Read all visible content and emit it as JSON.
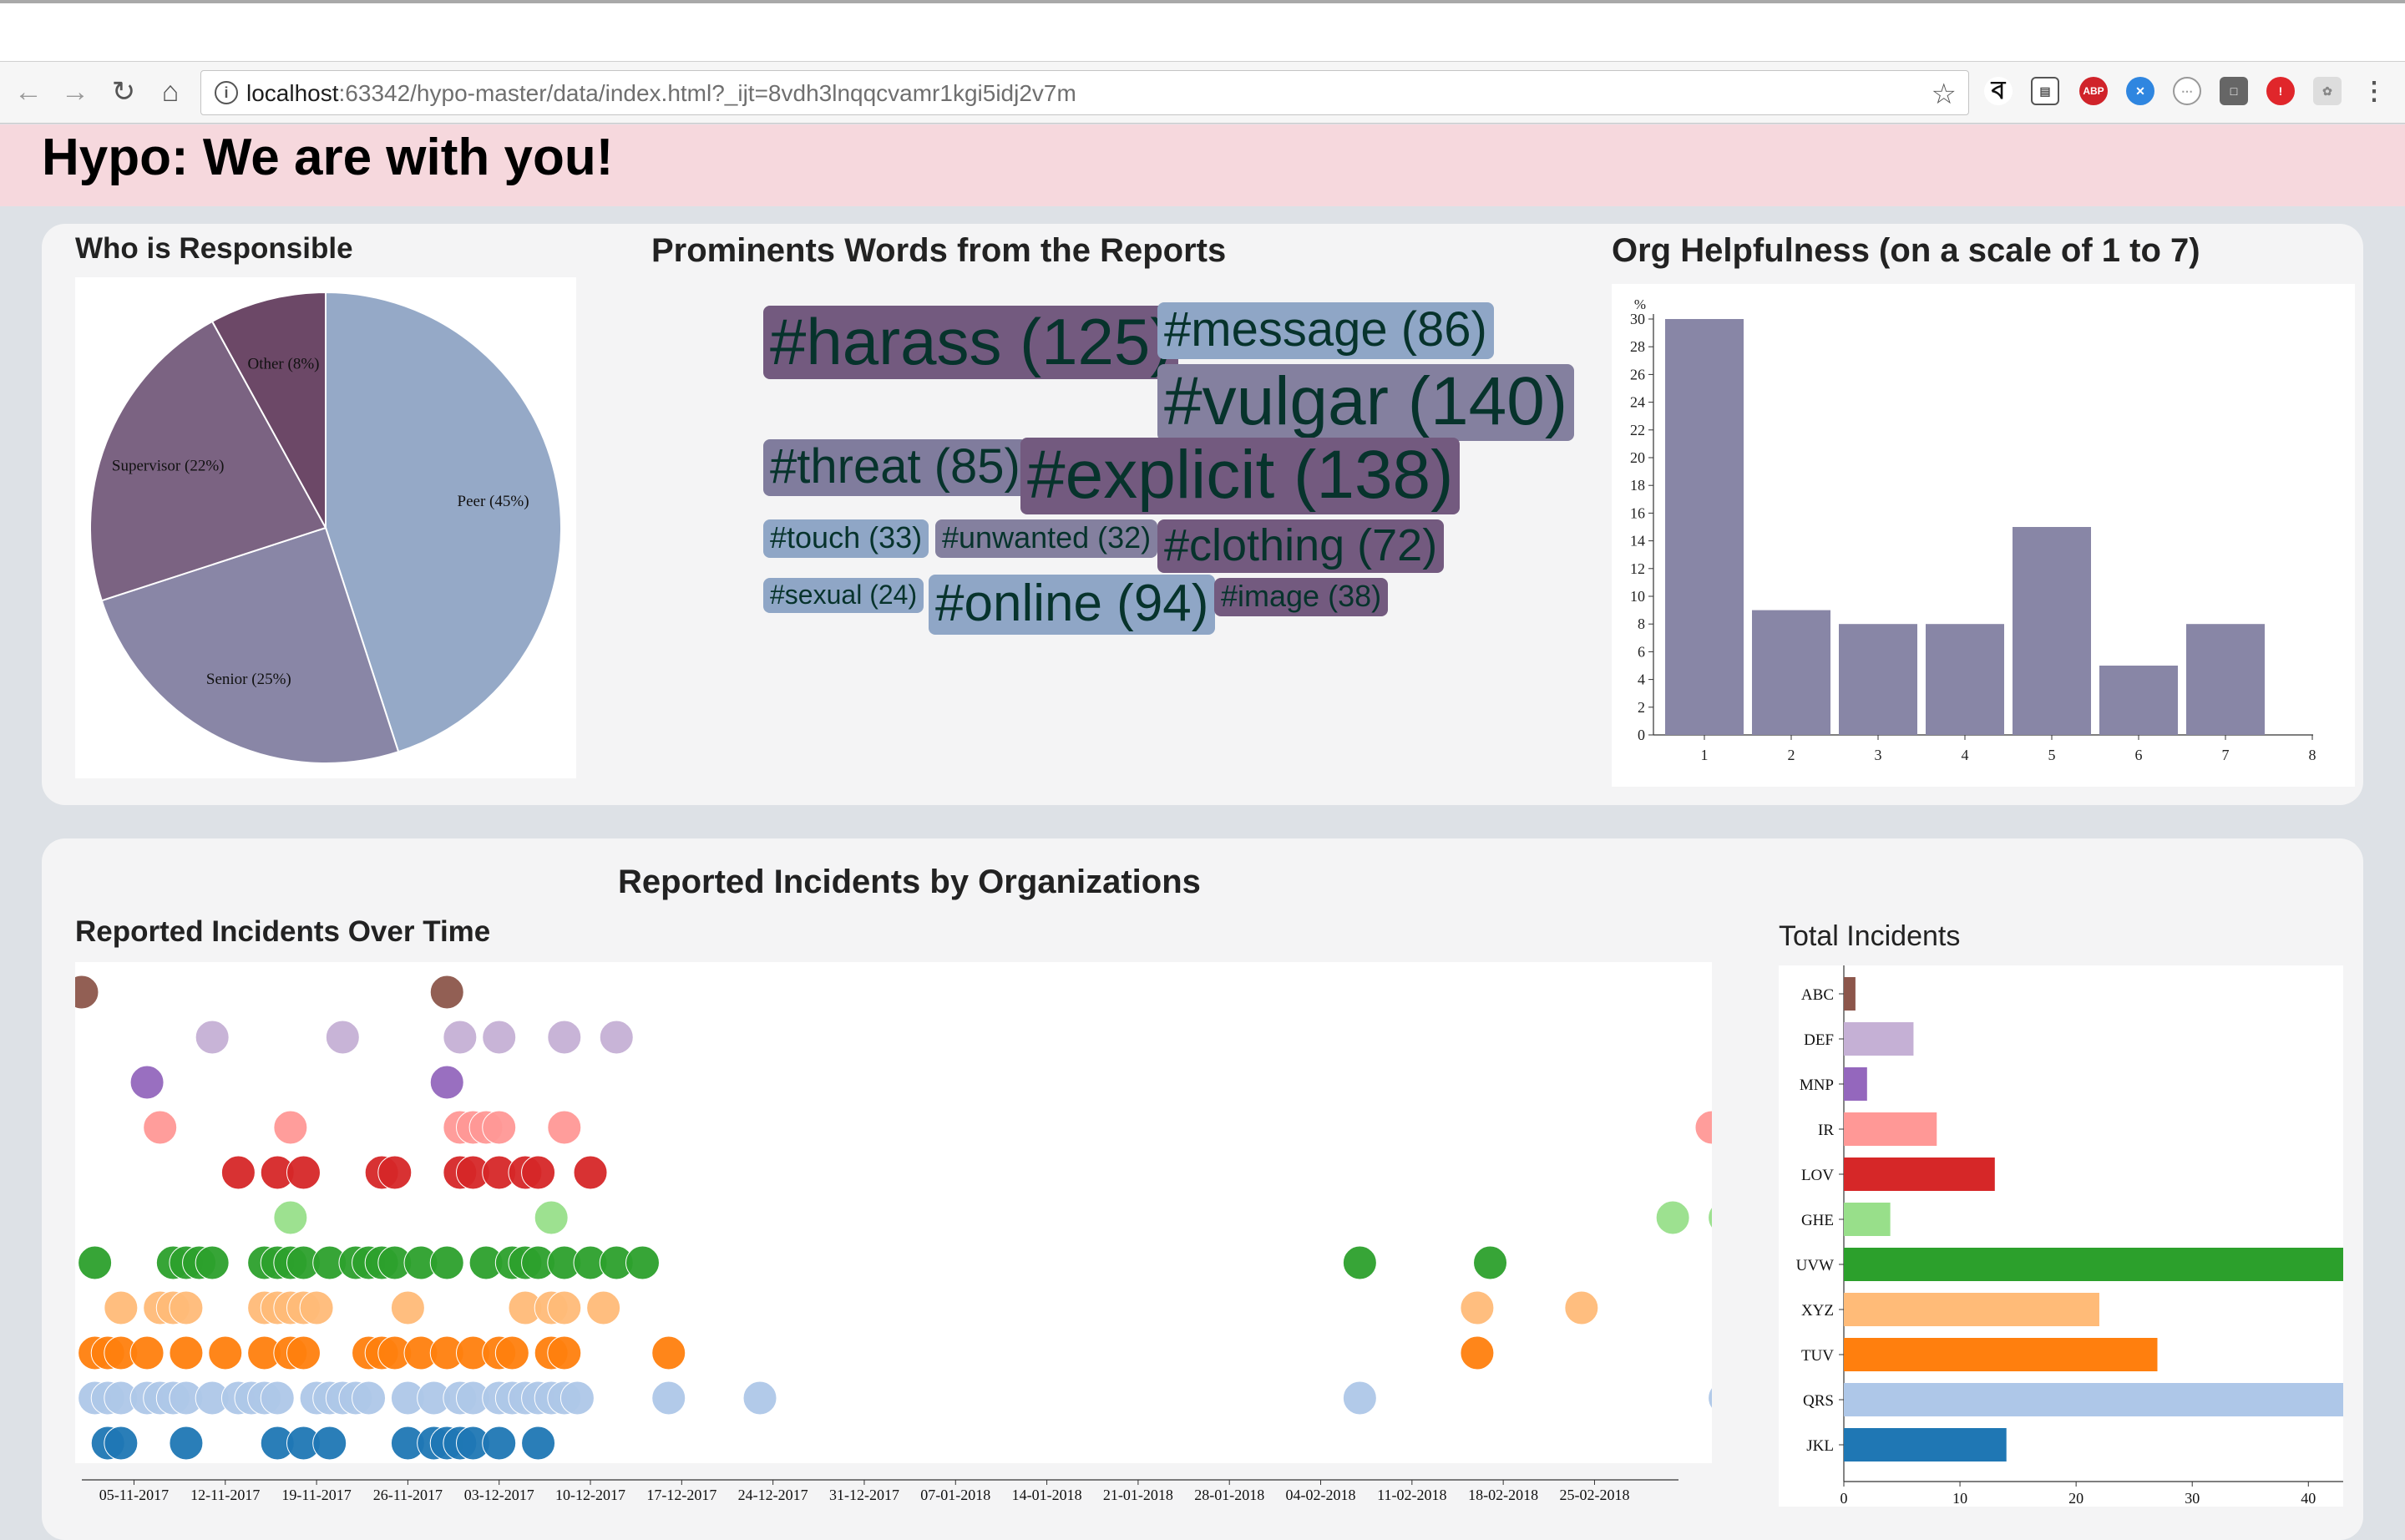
{
  "browser": {
    "url_host": "localhost",
    "url_rest": ":63342/hypo-master/data/index.html?_ijt=8vdh3lnqqcvamr1kgi5idj2v7m"
  },
  "header": {
    "title": "Hypo: We are with you!"
  },
  "responsible": {
    "title": "Who is Responsible",
    "chart_data": {
      "type": "pie",
      "slices": [
        {
          "label": "Peer (45%)",
          "value": 45,
          "color": "#95a9c7"
        },
        {
          "label": "Senior (25%)",
          "value": 25,
          "color": "#8986a6"
        },
        {
          "label": "Supervisor (22%)",
          "value": 22,
          "color": "#7b6382"
        },
        {
          "label": "Other (8%)",
          "value": 8,
          "color": "#6c4867"
        }
      ]
    }
  },
  "words": {
    "title": "Prominents Words from the Reports",
    "items": [
      {
        "text": "#harass (125)",
        "color": "#735a7f"
      },
      {
        "text": "#message (86)",
        "color": "#8fa6c6"
      },
      {
        "text": "#vulgar (140)",
        "color": "#84809f"
      },
      {
        "text": "#threat (85)",
        "color": "#807c9d"
      },
      {
        "text": "#explicit (138)",
        "color": "#735a7f"
      },
      {
        "text": "#touch (33)",
        "color": "#8fa6c6"
      },
      {
        "text": "#unwanted (32)",
        "color": "#84809f"
      },
      {
        "text": "#clothing (72)",
        "color": "#735a7f"
      },
      {
        "text": "#sexual (24)",
        "color": "#8fa6c6"
      },
      {
        "text": "#online (94)",
        "color": "#8fa6c6"
      },
      {
        "text": "#image (38)",
        "color": "#735a7f"
      }
    ]
  },
  "helpfulness": {
    "title": "Org Helpfulness (on a scale of 1 to 7)",
    "chart_data": {
      "type": "bar",
      "categories": [
        "1",
        "2",
        "3",
        "4",
        "5",
        "6",
        "7",
        "8"
      ],
      "values": [
        30,
        9,
        8,
        8,
        15,
        5,
        8,
        0
      ],
      "ylabel": "%",
      "ylim": [
        0,
        30
      ],
      "yticks": [
        0,
        2,
        4,
        6,
        8,
        10,
        12,
        14,
        16,
        18,
        20,
        22,
        24,
        26,
        28,
        30
      ],
      "bar_color": "#8886a6"
    }
  },
  "incidents": {
    "title": "Reported Incidents by Organizations",
    "over_time": {
      "title": "Reported Incidents Over Time",
      "chart_data": {
        "type": "scatter",
        "x_axis": "date",
        "xlim": [
          "2017-11-01",
          "2018-03-06"
        ],
        "tick_labels": [
          "05-11-2017",
          "12-11-2017",
          "19-11-2017",
          "26-11-2017",
          "03-12-2017",
          "10-12-2017",
          "17-12-2017",
          "24-12-2017",
          "31-12-2017",
          "07-01-2018",
          "14-01-2018",
          "21-01-2018",
          "28-01-2018",
          "04-02-2018",
          "11-02-2018",
          "18-02-2018",
          "25-02-2018"
        ],
        "series": [
          {
            "name": "ABC",
            "color": "#8c564b",
            "dates": [
              "2017-11-01",
              "2017-11-29"
            ]
          },
          {
            "name": "DEF",
            "color": "#c5b0d5",
            "dates": [
              "2017-11-11",
              "2017-11-21",
              "2017-11-30",
              "2017-12-03",
              "2017-12-08",
              "2017-12-12"
            ]
          },
          {
            "name": "MNP",
            "color": "#9467bd",
            "dates": [
              "2017-11-06",
              "2017-11-29"
            ]
          },
          {
            "name": "IR",
            "color": "#ff9896",
            "dates": [
              "2017-11-07",
              "2017-11-17",
              "2017-11-30",
              "2017-12-01",
              "2017-12-02",
              "2017-12-03",
              "2017-12-08",
              "2018-03-06"
            ]
          },
          {
            "name": "LOV",
            "color": "#d62728",
            "dates": [
              "2017-11-13",
              "2017-11-16",
              "2017-11-18",
              "2017-11-24",
              "2017-11-25",
              "2017-11-30",
              "2017-12-01",
              "2017-12-03",
              "2017-12-05",
              "2017-12-06",
              "2017-12-10"
            ]
          },
          {
            "name": "GHE",
            "color": "#98df8a",
            "dates": [
              "2017-11-17",
              "2017-12-07",
              "2018-03-03",
              "2018-03-07"
            ]
          },
          {
            "name": "UVW",
            "color": "#2ca02c",
            "dates": [
              "2017-11-02",
              "2017-11-08",
              "2017-11-09",
              "2017-11-10",
              "2017-11-11",
              "2017-11-15",
              "2017-11-16",
              "2017-11-17",
              "2017-11-18",
              "2017-11-20",
              "2017-11-22",
              "2017-11-23",
              "2017-11-24",
              "2017-11-25",
              "2017-11-27",
              "2017-11-29",
              "2017-12-02",
              "2017-12-04",
              "2017-12-05",
              "2017-12-06",
              "2017-12-08",
              "2017-12-10",
              "2017-12-12",
              "2017-12-14",
              "2018-02-07",
              "2018-02-17"
            ]
          },
          {
            "name": "XYZ",
            "color": "#ffbb78",
            "dates": [
              "2017-11-04",
              "2017-11-07",
              "2017-11-08",
              "2017-11-09",
              "2017-11-15",
              "2017-11-16",
              "2017-11-17",
              "2017-11-18",
              "2017-11-19",
              "2017-11-26",
              "2017-12-05",
              "2017-12-07",
              "2017-12-08",
              "2017-12-11",
              "2018-02-16",
              "2018-02-24"
            ]
          },
          {
            "name": "TUV",
            "color": "#ff7f0e",
            "dates": [
              "2017-11-02",
              "2017-11-03",
              "2017-11-04",
              "2017-11-06",
              "2017-11-09",
              "2017-11-12",
              "2017-11-15",
              "2017-11-17",
              "2017-11-18",
              "2017-11-23",
              "2017-11-24",
              "2017-11-25",
              "2017-11-27",
              "2017-11-29",
              "2017-12-01",
              "2017-12-03",
              "2017-12-04",
              "2017-12-07",
              "2017-12-08",
              "2017-12-16",
              "2018-02-16"
            ]
          },
          {
            "name": "QRS",
            "color": "#aec7e8",
            "dates": [
              "2017-11-02",
              "2017-11-03",
              "2017-11-04",
              "2017-11-06",
              "2017-11-07",
              "2017-11-08",
              "2017-11-09",
              "2017-11-11",
              "2017-11-13",
              "2017-11-14",
              "2017-11-15",
              "2017-11-16",
              "2017-11-19",
              "2017-11-20",
              "2017-11-21",
              "2017-11-22",
              "2017-11-23",
              "2017-11-26",
              "2017-11-28",
              "2017-11-30",
              "2017-12-01",
              "2017-12-03",
              "2017-12-04",
              "2017-12-05",
              "2017-12-06",
              "2017-12-07",
              "2017-12-08",
              "2017-12-09",
              "2017-12-16",
              "2017-12-23",
              "2018-02-07",
              "2018-03-07"
            ]
          },
          {
            "name": "JKL",
            "color": "#1f77b4",
            "dates": [
              "2017-11-03",
              "2017-11-04",
              "2017-11-09",
              "2017-11-16",
              "2017-11-18",
              "2017-11-20",
              "2017-11-26",
              "2017-11-28",
              "2017-11-29",
              "2017-11-30",
              "2017-12-01",
              "2017-12-03",
              "2017-12-06"
            ]
          }
        ]
      }
    },
    "totals": {
      "title": "Total Incidents",
      "chart_data": {
        "type": "bar",
        "orientation": "horizontal",
        "categories": [
          "ABC",
          "DEF",
          "MNP",
          "IR",
          "LOV",
          "GHE",
          "UVW",
          "XYZ",
          "TUV",
          "QRS",
          "JKL"
        ],
        "values": [
          1,
          6,
          2,
          8,
          13,
          4,
          43,
          22,
          27,
          45,
          14
        ],
        "colors": [
          "#8c564b",
          "#c5b0d5",
          "#9467bd",
          "#ff9896",
          "#d62728",
          "#98df8a",
          "#2ca02c",
          "#ffbb78",
          "#ff7f0e",
          "#aec7e8",
          "#1f77b4"
        ],
        "xticks": [
          0,
          10,
          20,
          30,
          40
        ],
        "xlim": [
          0,
          43
        ]
      }
    }
  }
}
